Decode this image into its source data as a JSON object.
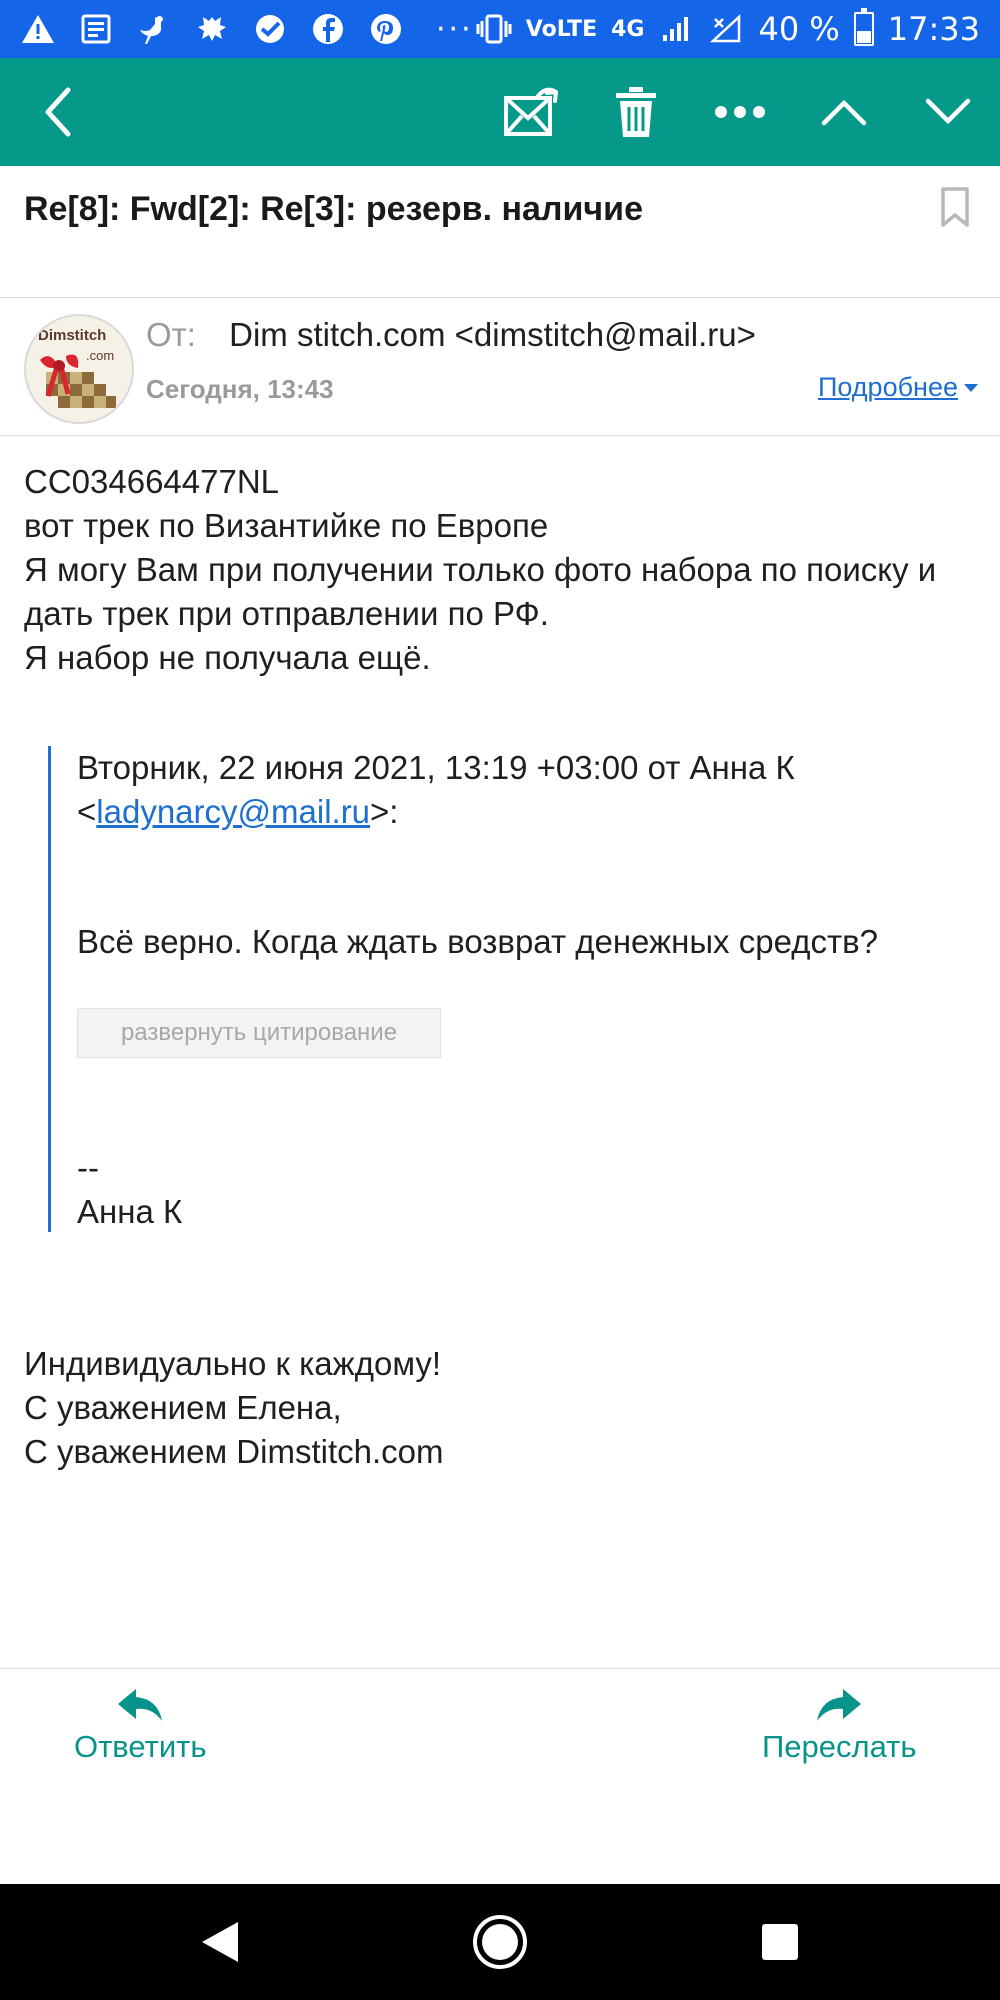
{
  "status_bar": {
    "network": "VoLTE",
    "net_badge": "4G",
    "battery": "40 %",
    "battery_level": 0.4,
    "time": "17:33",
    "more": "···"
  },
  "toolbar": {
    "icons": [
      "back-arrow-icon",
      "mark-unread-icon",
      "trash-icon",
      "more-icon",
      "prev-message-icon",
      "next-message-icon"
    ]
  },
  "message": {
    "subject": "Re[8]: Fwd[2]: Re[3]: резерв. наличие",
    "from_label": "От:",
    "from_value": "Dim stitch.com <dimstitch@mail.ru>",
    "date": "Сегодня, 13:43",
    "details_link": "Подробнее",
    "avatar_text_1": "Dimstitch",
    "avatar_text_2": ".com",
    "body": [
      "CC034664477NL",
      "вот трек по Византийке по Европе",
      "Я могу Вам при получении только фото набора по поиску и дать трек при отправлении по РФ.",
      "Я набор не получала ещё."
    ],
    "quote": {
      "header_prefix": "Вторник, 22 июня 2021, 13:19 +03:00 от Анна К",
      "open_bracket": "<",
      "email": "ladynarcy@mail.ru",
      "close_bracket": ">:",
      "text": "Всё верно. Когда ждать возврат денежных средств?",
      "expand_button": "развернуть цитирование",
      "sig_dash": "--",
      "sig_name": "Анна К"
    },
    "signature": [
      "Индивидуально к каждому!",
      "С уважением Елена,",
      "С уважением Dimstitch.com"
    ]
  },
  "actions": {
    "reply": "Ответить",
    "forward": "Переслать"
  },
  "colors": {
    "status_bar": "#1565e8",
    "toolbar": "#05998a",
    "link": "#1e6fd0",
    "action": "#07938a"
  }
}
